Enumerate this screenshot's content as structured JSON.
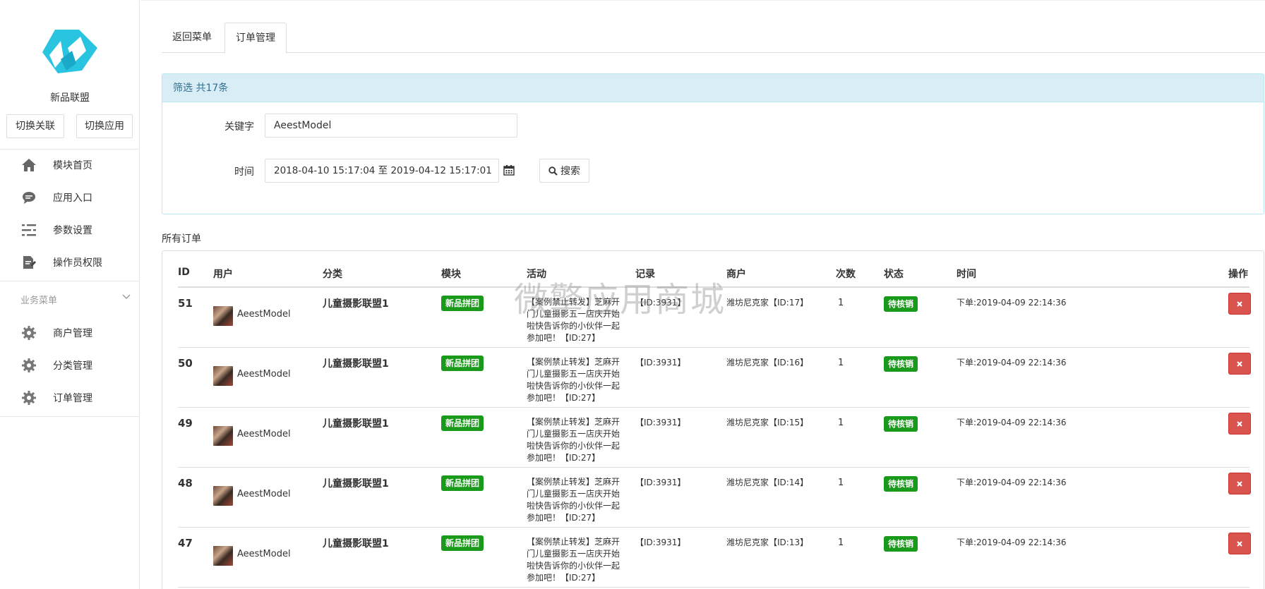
{
  "sidebar": {
    "brand": "新品联盟",
    "switch_buttons": [
      "切换关联",
      "切换应用"
    ],
    "items": [
      {
        "label": "模块首页",
        "icon": "home-icon"
      },
      {
        "label": "应用入口",
        "icon": "chat-icon"
      },
      {
        "label": "参数设置",
        "icon": "list-settings-icon"
      },
      {
        "label": "操作员权限",
        "icon": "document-edit-icon"
      }
    ],
    "group_title": "业务菜单",
    "group_items": [
      {
        "label": "商户管理",
        "icon": "gear-icon"
      },
      {
        "label": "分类管理",
        "icon": "gear-icon"
      },
      {
        "label": "订单管理",
        "icon": "gear-icon"
      }
    ]
  },
  "tabs": [
    "返回菜单",
    "订单管理"
  ],
  "filter": {
    "header": "筛选 共17条",
    "keyword_label": "关键字",
    "keyword_value": "AeestModel",
    "time_label": "时间",
    "time_value": "2018-04-10 15:17:04 至 2019-04-12 15:17:01",
    "search_label": "搜索"
  },
  "section_title": "所有订单",
  "table": {
    "headers": [
      "ID",
      "用户",
      "分类",
      "模块",
      "活动",
      "记录",
      "商户",
      "次数",
      "状态",
      "时间",
      "操作"
    ],
    "rows": [
      {
        "id": "51",
        "user": "AeestModel",
        "category": "儿童摄影联盟1",
        "module": "新品拼团",
        "activity": "【案例禁止转发】芝麻开门儿童摄影五一店庆开始啦快告诉你的小伙伴一起参加吧！【ID:27】",
        "record": "【ID:3931】",
        "merchant": "潍坊尼克家【ID:17】",
        "count": "1",
        "status": "待核销",
        "time": "下单:2019-04-09 22:14:36"
      },
      {
        "id": "50",
        "user": "AeestModel",
        "category": "儿童摄影联盟1",
        "module": "新品拼团",
        "activity": "【案例禁止转发】芝麻开门儿童摄影五一店庆开始啦快告诉你的小伙伴一起参加吧！【ID:27】",
        "record": "【ID:3931】",
        "merchant": "潍坊尼克家【ID:16】",
        "count": "1",
        "status": "待核销",
        "time": "下单:2019-04-09 22:14:36"
      },
      {
        "id": "49",
        "user": "AeestModel",
        "category": "儿童摄影联盟1",
        "module": "新品拼团",
        "activity": "【案例禁止转发】芝麻开门儿童摄影五一店庆开始啦快告诉你的小伙伴一起参加吧！【ID:27】",
        "record": "【ID:3931】",
        "merchant": "潍坊尼克家【ID:15】",
        "count": "1",
        "status": "待核销",
        "time": "下单:2019-04-09 22:14:36"
      },
      {
        "id": "48",
        "user": "AeestModel",
        "category": "儿童摄影联盟1",
        "module": "新品拼团",
        "activity": "【案例禁止转发】芝麻开门儿童摄影五一店庆开始啦快告诉你的小伙伴一起参加吧！【ID:27】",
        "record": "【ID:3931】",
        "merchant": "潍坊尼克家【ID:14】",
        "count": "1",
        "status": "待核销",
        "time": "下单:2019-04-09 22:14:36"
      },
      {
        "id": "47",
        "user": "AeestModel",
        "category": "儿童摄影联盟1",
        "module": "新品拼团",
        "activity": "【案例禁止转发】芝麻开门儿童摄影五一店庆开始啦快告诉你的小伙伴一起参加吧！【ID:27】",
        "record": "【ID:3931】",
        "merchant": "潍坊尼克家【ID:13】",
        "count": "1",
        "status": "待核销",
        "time": "下单:2019-04-09 22:14:36"
      }
    ]
  },
  "watermark": "微擎应用商城",
  "colors": {
    "badge_green": "#1a9a1a",
    "delete_red": "#d9534f",
    "filter_header_bg": "#d9edf7",
    "filter_header_text": "#31708f",
    "logo_cyan": "#29c4e0"
  }
}
